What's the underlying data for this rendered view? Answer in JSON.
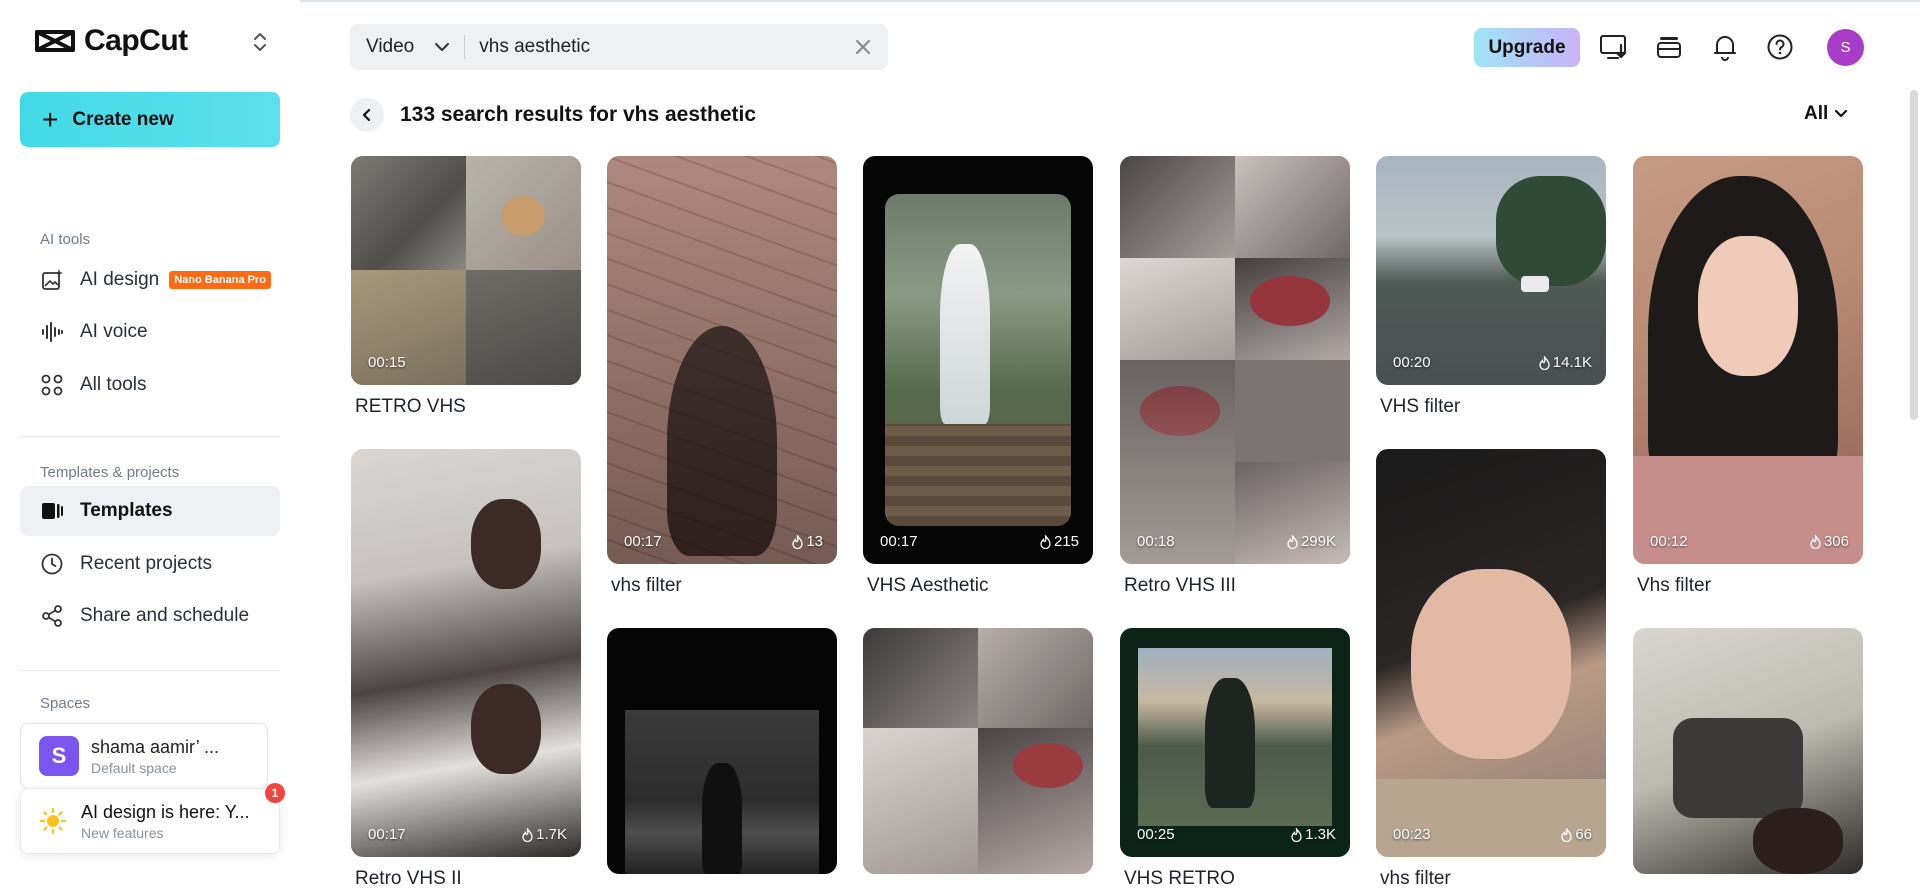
{
  "app": {
    "name": "CapCut"
  },
  "sidebar": {
    "create_label": "Create new",
    "ai_tools_title": "AI tools",
    "ai_design": "AI design",
    "ai_design_badge": "Nano Banana Pro",
    "ai_voice": "AI voice",
    "all_tools": "All tools",
    "templates_title": "Templates & projects",
    "templates": "Templates",
    "recent_projects": "Recent projects",
    "share_schedule": "Share and schedule",
    "spaces_title": "Spaces",
    "space_initial": "S",
    "space_name": "shama aamir’ ...",
    "space_sub": "Default space",
    "news_title": "AI design is here: Y...",
    "news_sub": "New features",
    "news_count": "1"
  },
  "header": {
    "search_type": "Video",
    "search_value": "vhs aesthetic",
    "upgrade": "Upgrade",
    "avatar_initial": "S"
  },
  "results": {
    "title": "133 search results for vhs aesthetic",
    "filter": "All"
  },
  "cards": [
    {
      "title": "RETRO VHS",
      "duration": "00:15",
      "uses": ""
    },
    {
      "title": "vhs filter",
      "duration": "00:17",
      "uses": "13"
    },
    {
      "title": "VHS Aesthetic",
      "duration": "00:17",
      "uses": "215"
    },
    {
      "title": "Retro VHS III",
      "duration": "00:18",
      "uses": "299K"
    },
    {
      "title": "VHS filter",
      "duration": "00:20",
      "uses": "14.1K"
    },
    {
      "title": "Vhs filter",
      "duration": "00:12",
      "uses": "306"
    },
    {
      "title": "Retro VHS II",
      "duration": "00:17",
      "uses": "1.7K"
    },
    {
      "title": "",
      "duration": "",
      "uses": ""
    },
    {
      "title": "",
      "duration": "",
      "uses": ""
    },
    {
      "title": "VHS RETRO",
      "duration": "00:25",
      "uses": "1.3K"
    },
    {
      "title": "vhs filter",
      "duration": "00:23",
      "uses": "66"
    },
    {
      "title": "",
      "duration": "",
      "uses": ""
    }
  ],
  "colors": {
    "accent": "#42d9e6",
    "avatar": "#a63cc8",
    "badge": "#ff6a14"
  }
}
